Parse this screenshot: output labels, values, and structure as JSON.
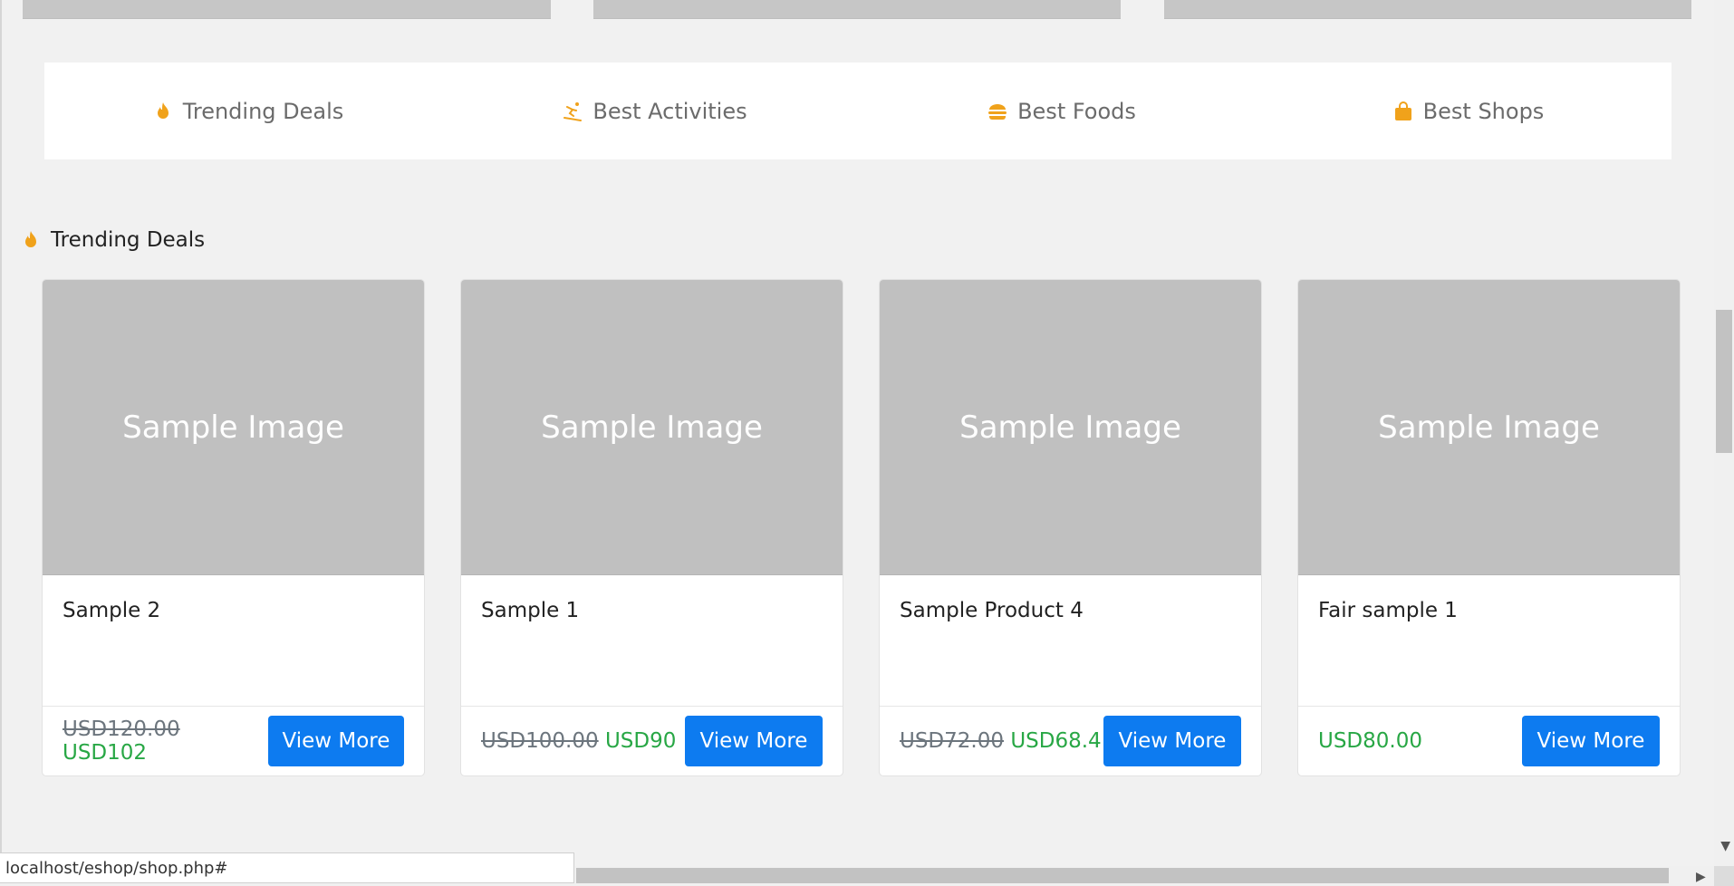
{
  "tabs": [
    {
      "label": "Trending Deals",
      "icon": "fire-icon"
    },
    {
      "label": "Best Activities",
      "icon": "skiing-icon"
    },
    {
      "label": "Best Foods",
      "icon": "burger-icon"
    },
    {
      "label": "Best Shops",
      "icon": "shopping-bag-icon"
    }
  ],
  "section": {
    "title": "Trending Deals",
    "icon": "fire-icon"
  },
  "products": [
    {
      "image_text": "Sample Image",
      "name": "Sample 2",
      "old_price": "USD120.00",
      "price": "USD102",
      "button": "View More"
    },
    {
      "image_text": "Sample Image",
      "name": "Sample 1",
      "old_price": "USD100.00",
      "price": "USD90",
      "button": "View More"
    },
    {
      "image_text": "Sample Image",
      "name": "Sample Product 4",
      "old_price": "USD72.00",
      "price": "USD68.4",
      "button": "View More"
    },
    {
      "image_text": "Sample Image",
      "name": "Fair sample 1",
      "old_price": "",
      "price": "USD80.00",
      "button": "View More"
    }
  ],
  "status_url": "localhost/eshop/shop.php#",
  "colors": {
    "accent": "#f0a21b",
    "button": "#0d7bf0",
    "price": "#28a745"
  }
}
